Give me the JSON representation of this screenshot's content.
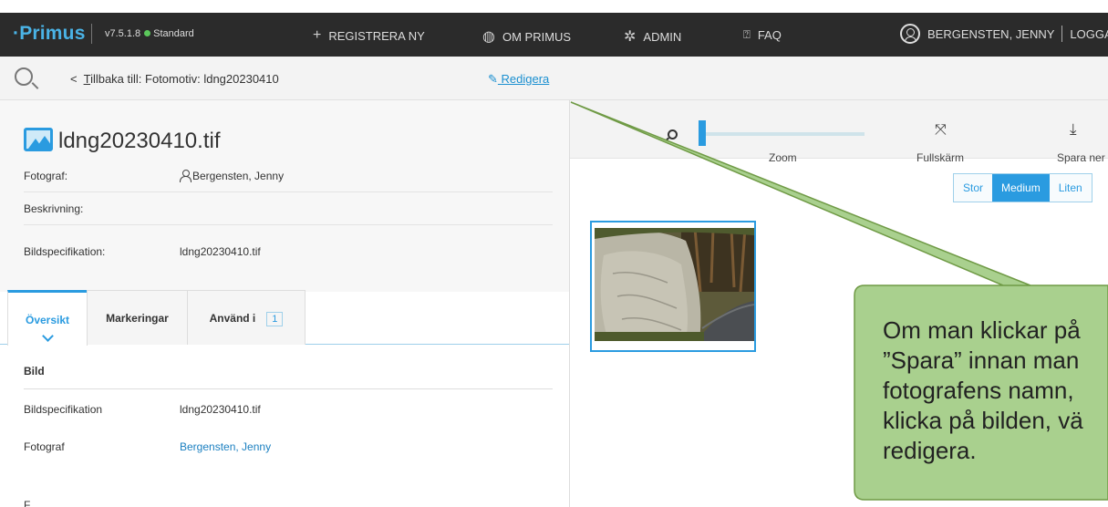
{
  "header": {
    "logo": "·Primus",
    "version": "v7.5.1.8",
    "edition": "Standard",
    "nav": {
      "register": "REGISTRERA NY",
      "about": "OM PRIMUS",
      "admin": "ADMIN",
      "faq": "FAQ"
    },
    "user": "BERGENSTEN, JENNY",
    "logout": "LOGGA"
  },
  "crumb": {
    "back_prefix": "T",
    "back_rest": "illbaka till: Fotomotiv: ldng20230410",
    "edit": "Redigera"
  },
  "record": {
    "title": "ldng20230410.tif",
    "fields": [
      {
        "label": "Fotograf:",
        "value": "Bergensten, Jenny"
      },
      {
        "label": "Beskrivning:",
        "value": ""
      },
      {
        "label": "Bildspecifikation:",
        "value": "ldng20230410.tif"
      }
    ]
  },
  "tabs": {
    "overview": "Översikt",
    "markings": "Markeringar",
    "used_in": "Använd i",
    "used_in_count": "1"
  },
  "details": {
    "section": "Bild",
    "rows": [
      {
        "label": "Bildspecifikation",
        "value": "ldng20230410.tif"
      },
      {
        "label": "Fotograf",
        "value": "Bergensten, Jenny"
      }
    ],
    "cut_label": "F"
  },
  "viewer": {
    "zoom": "Zoom",
    "fullscreen": "Fullskärm",
    "download": "Spara ner",
    "sizes": [
      "Stor",
      "Medium",
      "Liten"
    ],
    "selected_size": "Medium"
  },
  "callout": {
    "lines": [
      "Om man klickar på",
      "”Spara” innan man",
      "fotografens namn,",
      "klicka på bilden, vä",
      "redigera."
    ]
  },
  "colors": {
    "accent": "#2a9be0",
    "callout_fill": "#a9d08e",
    "callout_stroke": "#6f9a45",
    "topbar": "#2b2b2b"
  }
}
